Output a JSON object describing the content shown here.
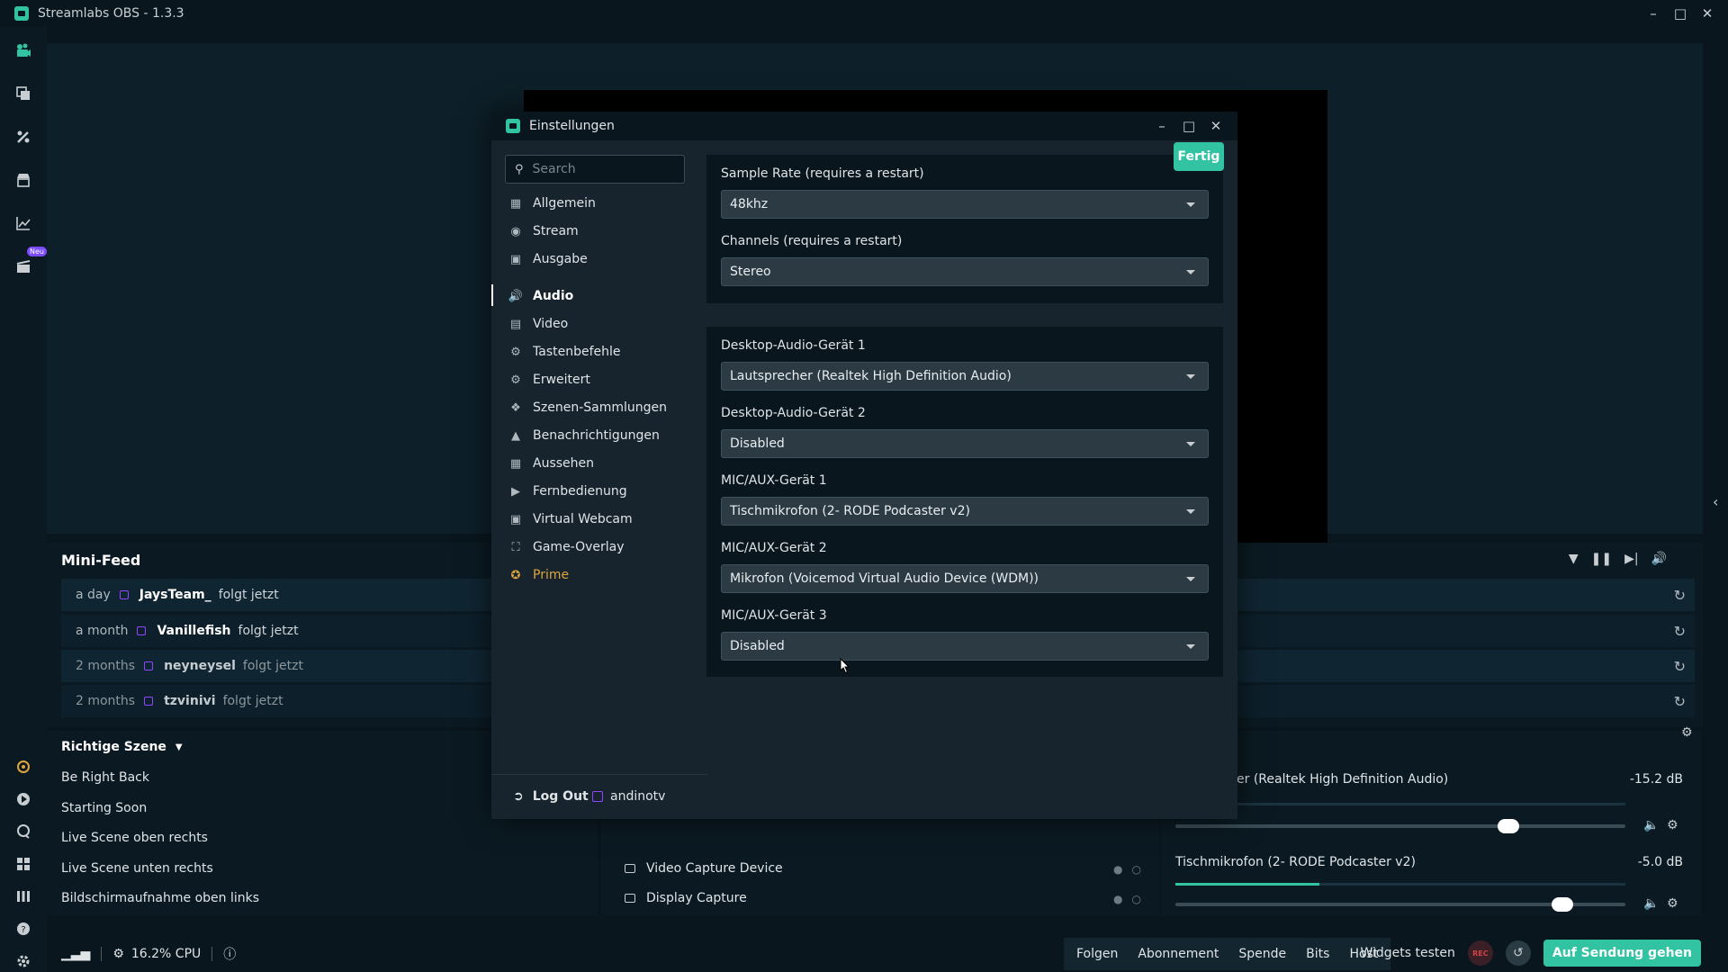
{
  "window": {
    "title": "Streamlabs OBS - 1.3.3"
  },
  "nav": {
    "neu_badge": "Neu"
  },
  "minifeed": {
    "title": "Mini-Feed",
    "rows": [
      {
        "time": "a day",
        "name": "JaysTeam_",
        "action": "folgt jetzt"
      },
      {
        "time": "a month",
        "name": "Vanillefish",
        "action": "folgt jetzt"
      },
      {
        "time": "2 months",
        "name": "neyneysel",
        "action": "folgt jetzt"
      },
      {
        "time": "2 months",
        "name": "tzvinivi",
        "action": "folgt jetzt"
      }
    ]
  },
  "scenes": {
    "title": "Richtige Szene",
    "items": [
      "Be Right Back",
      "Starting Soon",
      "Live Scene oben rechts",
      "Live Scene unten rechts",
      "Bildschirmaufnahme oben links"
    ]
  },
  "sources": {
    "items": [
      "Video Capture Device",
      "Display Capture"
    ]
  },
  "mixer": {
    "items": [
      {
        "label": "er (Realtek High Definition Audio)",
        "db": "-15.2 dB",
        "level": 0.0,
        "volume": 0.74
      },
      {
        "label": "Tischmikrofon (2- RODE Podcaster v2)",
        "db": "-5.0 dB",
        "level": 0.32,
        "volume": 0.86
      }
    ]
  },
  "statusbar": {
    "cpu": "16.2% CPU",
    "tabs": [
      "Folgen",
      "Abonnement",
      "Spende",
      "Bits",
      "Host"
    ],
    "widgets_test": "Widgets testen",
    "rec": "REC",
    "go_live": "Auf Sendung gehen"
  },
  "settings": {
    "title": "Einstellungen",
    "search_placeholder": "Search",
    "menu": [
      "Allgemein",
      "Stream",
      "Ausgabe",
      "Audio",
      "Video",
      "Tastenbefehle",
      "Erweitert",
      "Szenen-Sammlungen",
      "Benachrichtigungen",
      "Aussehen",
      "Fernbedienung",
      "Virtual Webcam",
      "Game-Overlay",
      "Prime"
    ],
    "active": "Audio",
    "logout": "Log Out",
    "username": "andinotv",
    "done": "Fertig",
    "panel1": [
      {
        "label": "Sample Rate (requires a restart)",
        "value": "48khz"
      },
      {
        "label": "Channels (requires a restart)",
        "value": "Stereo"
      }
    ],
    "panel2": [
      {
        "label": "Desktop-Audio-Gerät 1",
        "value": "Lautsprecher (Realtek High Definition Audio)"
      },
      {
        "label": "Desktop-Audio-Gerät 2",
        "value": "Disabled"
      },
      {
        "label": "MIC/AUX-Gerät 1",
        "value": "Tischmikrofon (2- RODE Podcaster v2)"
      },
      {
        "label": "MIC/AUX-Gerät 2",
        "value": "Mikrofon (Voicemod Virtual Audio Device (WDM))"
      },
      {
        "label": "MIC/AUX-Gerät 3",
        "value": "Disabled"
      }
    ]
  }
}
